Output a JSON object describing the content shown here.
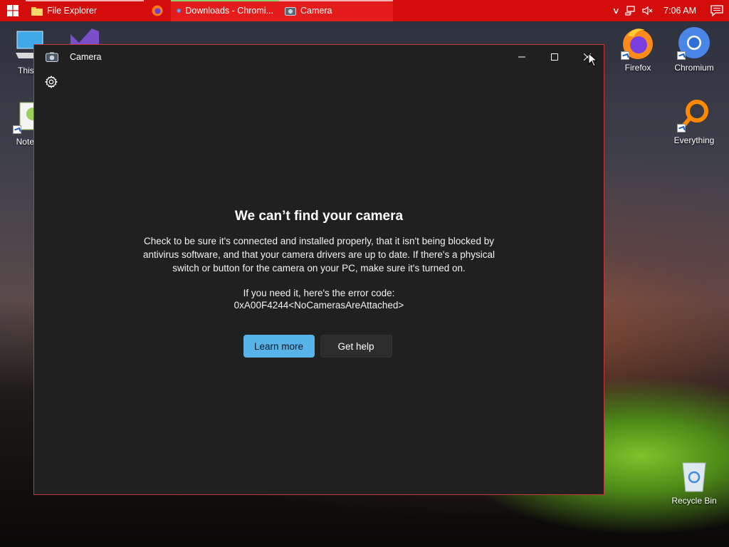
{
  "taskbar": {
    "tasks": [
      {
        "label": "File Explorer",
        "icon": "folder-icon"
      },
      {
        "label": "",
        "icon": "firefox-icon"
      },
      {
        "label": "Downloads - Chromi...",
        "icon": "chromium-icon"
      },
      {
        "label": "Camera",
        "icon": "camera-icon"
      }
    ],
    "clock": "7:06 AM",
    "accent_color": "#d30c0c"
  },
  "desktop": {
    "icons": [
      {
        "label": "This P",
        "icon": "this-pc-icon"
      },
      {
        "label": "Notepa",
        "icon": "notepad-icon"
      },
      {
        "label": "Firefox",
        "icon": "firefox-icon"
      },
      {
        "label": "Chromium",
        "icon": "chromium-icon"
      },
      {
        "label": "Everything",
        "icon": "everything-search-icon"
      },
      {
        "label": "Recycle Bin",
        "icon": "recycle-bin-icon"
      }
    ]
  },
  "window": {
    "title": "Camera",
    "heading": "We can’t find your camera",
    "body": "Check to be sure it's connected and installed properly, that it isn't being blocked by antivirus software, and that your camera drivers are up to date. If there's a physical switch or button for the camera on your PC, make sure it's turned on.",
    "error_lead": "If you need it, here's the error code:",
    "error_code": "0xA00F4244<NoCamerasAreAttached>",
    "learn_more": "Learn more",
    "get_help": "Get help",
    "primary_color": "#58b4e8"
  }
}
